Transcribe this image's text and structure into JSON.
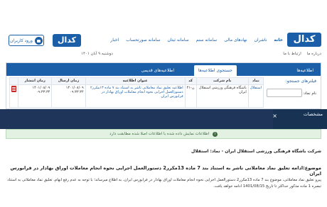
{
  "header": {
    "logo_text": "كدال",
    "login_label": "ورود کاربران",
    "nav": [
      "خانه",
      "ناشران",
      "نهادهای مالی",
      "سامانه سنم",
      "سامانه ثبتان",
      "سامانه صورتحساب",
      "اخبار"
    ],
    "date": "دوشنبه ۹ آبان ۱۴۰۱",
    "subnav": [
      "درباره ما",
      "ارتباط با ما"
    ]
  },
  "panel": {
    "tabs": [
      "اطلاعیه‌ها",
      "جستجوی اطلاعیه‌ها",
      "اطلاعیه‌های قدیمی"
    ],
    "filter_title": "فیلترهای جستجو:",
    "filter_label": "نام نماد:",
    "filter_select": "",
    "table": {
      "headers": [
        "نماد",
        "نام شرکت",
        "کد",
        "عنوان اطلاعیه",
        "زمان ارسال",
        "زمان انتشار"
      ],
      "row": {
        "symbol": "استقلال",
        "company": "باشگاه فرهنگی ورزشی استقلال ایران",
        "code": "ن-۴۱",
        "title": "اطلاعیه تعلیق نماد معاملاتی ناشر به استناد بند ۷ ماده ۱۳مکرر۲ دستورالعمل اجرایی نحوه انجام معاملات اوراق بهادار در فرابورس ایران",
        "sent": "۱۴۰۱/۰۸/۰۹ ۰۹:۳۳:۳۴",
        "published": "۱۴۰۱/۰۸/۰۹ ۰۹:۳۳:۳۴"
      }
    }
  },
  "darkbar": {
    "badge": "مشخصات"
  },
  "alert": {
    "text": "اطلاعات نمایش داده شده با اطلاعات اصلا شده مطابقت دارد"
  },
  "detail": {
    "company": "شرکت باشگاه فرهنگی ورزشی استقلال ایران - نماد: استقلال",
    "subject": "موضوع:ادامه تعلیق نماد معاملاتی ناشر به استناد بند 7 ماده 13مکرر2 دستورالعمل اجرایی نحوه انجام معاملات اوراق بهادار در فرابورس ایران",
    "body": "پیرو تعلیق نماد معاملاتی، موضوع بند 7 ماده 13مکرر2 دستورالعمل اجرایی نحوه انجام معاملات اوراق بهادار در فرابورس ایران، به اطلاع میرساند؛ با توجه به عدم رفع ابهام، تعلیق نماد معاملاتی به استناد تبصره 1 ماده مذکور حداکثر تا تاریخ 1401/08/15 ادامه خواهد یافت."
  },
  "colors": {
    "brand": "#1b5fa8",
    "darkbar": "#1f3559",
    "alert_bg": "#e3f1e3"
  }
}
